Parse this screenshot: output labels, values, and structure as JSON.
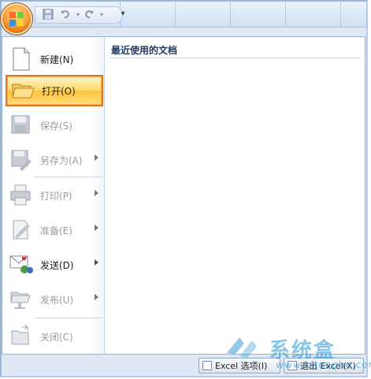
{
  "quick_access": {
    "save_icon": "save-icon",
    "undo_icon": "undo-icon",
    "redo_icon": "redo-icon",
    "customize_icon": "customize-icon"
  },
  "menu": {
    "items": [
      {
        "label": "新建(N)",
        "icon": "new-document-icon",
        "enabled": true,
        "submenu": false
      },
      {
        "label": "打开(O)",
        "icon": "open-folder-icon",
        "enabled": true,
        "submenu": false,
        "active": true
      },
      {
        "label": "保存(S)",
        "icon": "save-icon",
        "enabled": false,
        "submenu": false
      },
      {
        "label": "另存为(A)",
        "icon": "save-as-icon",
        "enabled": false,
        "submenu": true
      },
      {
        "label": "打印(P)",
        "icon": "print-icon",
        "enabled": false,
        "submenu": true
      },
      {
        "label": "准备(E)",
        "icon": "prepare-icon",
        "enabled": false,
        "submenu": true
      },
      {
        "label": "发送(D)",
        "icon": "send-icon",
        "enabled": true,
        "submenu": true
      },
      {
        "label": "发布(U)",
        "icon": "publish-icon",
        "enabled": false,
        "submenu": true
      },
      {
        "label": "关闭(C)",
        "icon": "close-document-icon",
        "enabled": false,
        "submenu": false
      }
    ],
    "recent_title": "最近使用的文档"
  },
  "bottom": {
    "options_label": "Excel 选项(I)",
    "exit_label": "退出 Excel(X)"
  },
  "watermark": {
    "text": "系统盒",
    "url": "www.xitonghe.com"
  },
  "colors": {
    "active_border": "#e8741a",
    "active_fill": "#ffd765",
    "office_button": "#f7a23b"
  }
}
